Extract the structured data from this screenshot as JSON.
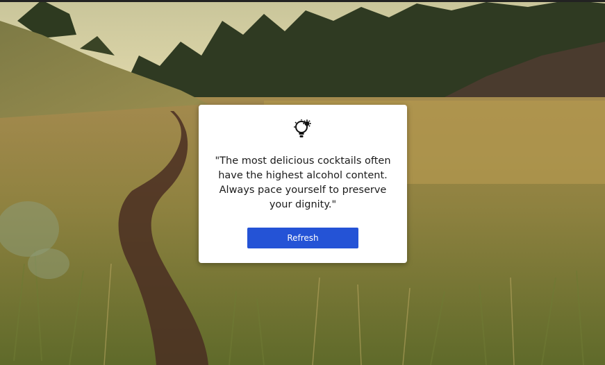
{
  "quote_card": {
    "icon": "lightbulb-gear-icon",
    "quote_text": "\"The most delicious cocktails often have the highest alcohol content. Always pace yourself to preserve your dignity.\"",
    "refresh_label": "Refresh"
  },
  "background": {
    "scene": "grassy-meadow-trail-pine-forest"
  },
  "colors": {
    "button": "#2453d6",
    "card": "#ffffff",
    "text": "#1b1b1b"
  }
}
